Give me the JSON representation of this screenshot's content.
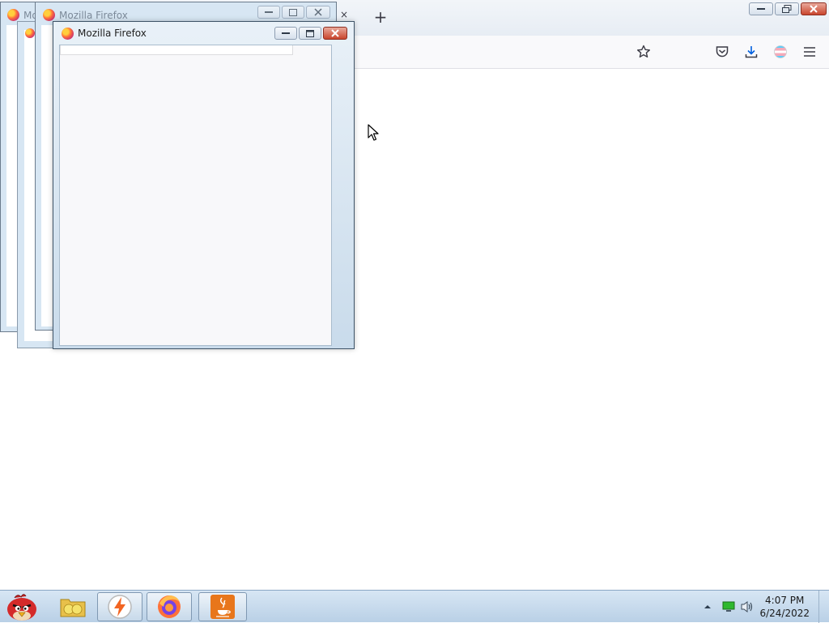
{
  "main_window": {
    "new_tab_label": "+",
    "tab_close_label": "×",
    "toolbar_icons": [
      "bookmark-star-icon",
      "pocket-icon",
      "downloads-icon",
      "account-icon",
      "menu-icon"
    ]
  },
  "background_windows": {
    "title_partial": "Mo",
    "title": "Mozilla Firefox"
  },
  "front_window": {
    "title": "Mozilla Firefox"
  },
  "taskbar": {
    "apps": [
      "angry-birds-icon",
      "file-explorer-icon",
      "flash-app-icon",
      "firefox-icon",
      "java-icon"
    ],
    "clock_time": "4:07 PM",
    "clock_date": "6/24/2022"
  },
  "colors": {
    "taskbar": "#b9d0e6",
    "close_button": "#c9452d",
    "firefox_accent": "#ff7139"
  }
}
